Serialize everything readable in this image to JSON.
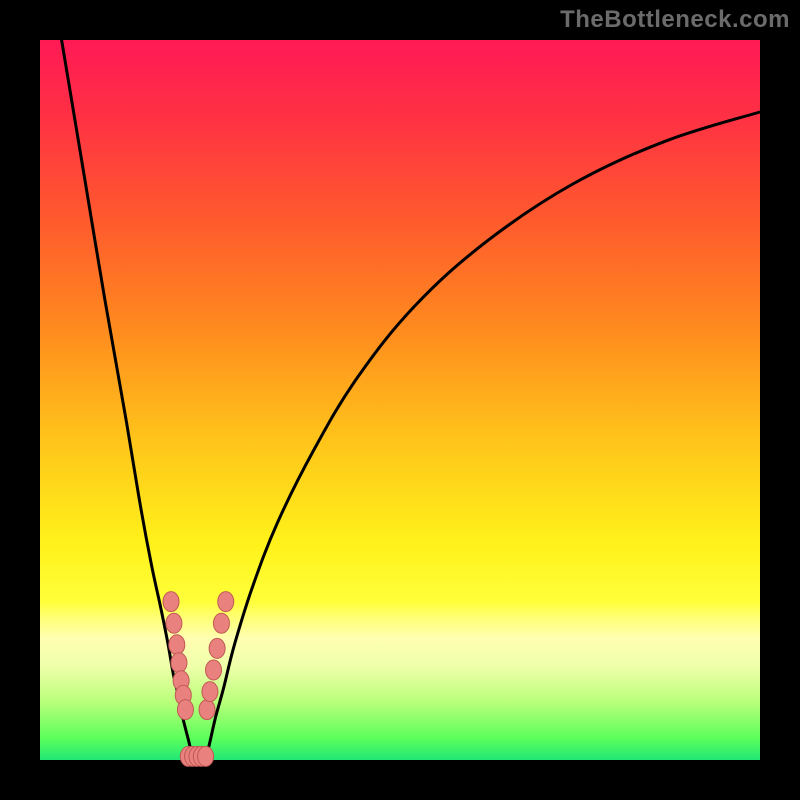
{
  "watermark": "TheBottleneck.com",
  "colors": {
    "dot_fill": "#e9827f",
    "dot_stroke": "#c05854",
    "curve": "#000000"
  },
  "chart_data": {
    "type": "line",
    "title": "",
    "xlabel": "",
    "ylabel": "",
    "xlim": [
      0,
      100
    ],
    "ylim": [
      0,
      100
    ],
    "gradient_stops": [
      {
        "t": 0.0,
        "color": "#ff1a55"
      },
      {
        "t": 0.1,
        "color": "#ff2f45"
      },
      {
        "t": 0.25,
        "color": "#ff5a2d"
      },
      {
        "t": 0.4,
        "color": "#ff8a1e"
      },
      {
        "t": 0.55,
        "color": "#ffc21a"
      },
      {
        "t": 0.7,
        "color": "#fff21a"
      },
      {
        "t": 0.78,
        "color": "#ffff3a"
      },
      {
        "t": 0.8,
        "color": "#ffff70"
      },
      {
        "t": 0.83,
        "color": "#ffffb0"
      },
      {
        "t": 0.87,
        "color": "#efffaa"
      },
      {
        "t": 0.92,
        "color": "#b8ff7a"
      },
      {
        "t": 0.97,
        "color": "#5bff5b"
      },
      {
        "t": 1.0,
        "color": "#20e676"
      }
    ],
    "series": [
      {
        "name": "left_branch",
        "x": [
          3.0,
          6.0,
          9.0,
          12.0,
          14.0,
          15.5,
          16.8,
          17.8,
          18.5,
          19.2,
          19.8,
          20.3,
          20.8,
          21.1
        ],
        "y": [
          100.0,
          82.0,
          64.0,
          47.0,
          35.0,
          27.0,
          21.0,
          16.0,
          12.0,
          9.0,
          6.0,
          4.0,
          2.0,
          0.0
        ]
      },
      {
        "name": "right_branch",
        "x": [
          23.0,
          23.6,
          24.4,
          25.5,
          27.0,
          29.5,
          33.0,
          38.0,
          44.0,
          52.0,
          62.0,
          74.0,
          87.0,
          100.0
        ],
        "y": [
          0.0,
          2.5,
          6.0,
          10.0,
          16.0,
          24.0,
          33.0,
          43.0,
          53.0,
          63.0,
          72.0,
          80.0,
          86.0,
          90.0
        ]
      }
    ],
    "sample_points": [
      {
        "x": 18.2,
        "y": 22.0
      },
      {
        "x": 18.6,
        "y": 19.0
      },
      {
        "x": 19.0,
        "y": 16.0
      },
      {
        "x": 19.3,
        "y": 13.5
      },
      {
        "x": 19.6,
        "y": 11.0
      },
      {
        "x": 19.9,
        "y": 9.0
      },
      {
        "x": 20.2,
        "y": 7.0
      },
      {
        "x": 23.2,
        "y": 7.0
      },
      {
        "x": 23.6,
        "y": 9.5
      },
      {
        "x": 24.1,
        "y": 12.5
      },
      {
        "x": 24.6,
        "y": 15.5
      },
      {
        "x": 25.2,
        "y": 19.0
      },
      {
        "x": 25.8,
        "y": 22.0
      },
      {
        "x": 20.6,
        "y": 0.5
      },
      {
        "x": 21.2,
        "y": 0.5
      },
      {
        "x": 21.8,
        "y": 0.5
      },
      {
        "x": 22.4,
        "y": 0.5
      },
      {
        "x": 23.0,
        "y": 0.5
      }
    ]
  }
}
